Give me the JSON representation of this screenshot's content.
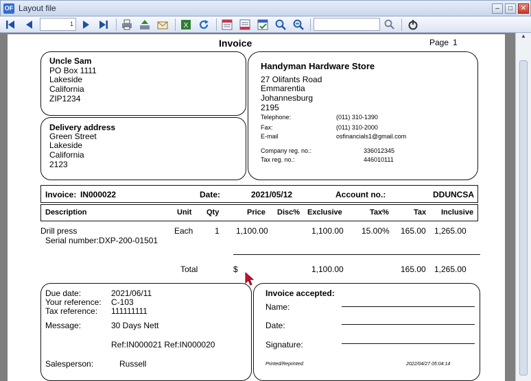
{
  "window": {
    "title": "Layout file",
    "app_icon": "OF"
  },
  "toolbar": {
    "page_number": "1",
    "search_value": "",
    "icons": [
      "first-page-icon",
      "previous-page-icon",
      "next-page-icon",
      "last-page-icon",
      "print-icon",
      "export-icon",
      "email-icon",
      "export-excel-icon",
      "refresh-icon",
      "page-layout-icon",
      "page-setup-icon",
      "check-icon",
      "zoom-in-icon",
      "zoom-out-icon",
      "search-icon",
      "exit-icon"
    ]
  },
  "invoice": {
    "title": "Invoice",
    "page_label": "Page",
    "page_number": "1",
    "customer": {
      "name": "Uncle Sam",
      "lines": [
        "PO Box 1111",
        "Lakeside",
        "California",
        "ZIP1234"
      ]
    },
    "delivery": {
      "heading": "Delivery address",
      "lines": [
        "Green Street",
        "Lakeside",
        "California",
        "2123"
      ]
    },
    "company": {
      "name": "Handyman Hardware Store",
      "lines": [
        "27 Olifants Road",
        "Emmarentia",
        "Johannesburg",
        "2195"
      ],
      "telephone_label": "Telephone:",
      "telephone": "(011) 310-1390",
      "fax_label": "Fax:",
      "fax": "(011) 310-2000",
      "email_label": "E-mail",
      "email": "osfinancials1@gmail.com",
      "reg_label": "Company reg. no.:",
      "reg": "336012345",
      "tax_label": "Tax reg. no.:",
      "tax": "446010111"
    },
    "header": {
      "invoice_label": "Invoice:",
      "invoice_no": "IN000022",
      "date_label": "Date:",
      "date": "2021/05/12",
      "account_label": "Account no.:",
      "account": "DDUNCSA"
    },
    "columns": {
      "description": "Description",
      "unit": "Unit",
      "qty": "Qty",
      "price": "Price",
      "disc": "Disc%",
      "exclusive": "Exclusive",
      "tax_pct": "Tax%",
      "tax": "Tax",
      "inclusive": "Inclusive"
    },
    "line_item": {
      "description": "Drill press",
      "serial": "Serial number:DXP-200-01501",
      "unit": "Each",
      "qty": "1",
      "price": "1,100.00",
      "exclusive": "1,100.00",
      "tax_pct": "15.00%",
      "tax": "165.00",
      "inclusive": "1,265.00"
    },
    "totals": {
      "label": "Total",
      "currency": "$",
      "exclusive": "1,100.00",
      "tax": "165.00",
      "inclusive": "1,265.00"
    },
    "footer": {
      "due_label": "Due date:",
      "due": "2021/06/11",
      "ref_label": "Your reference:",
      "ref": "C-103",
      "taxref_label": "Tax reference:",
      "taxref": "111111111",
      "message_label": "Message:",
      "message1": "30 Days Nett",
      "message2": "Ref:IN000021 Ref:IN000020",
      "sales_label": "Salesperson:",
      "sales": "Russell"
    },
    "accepted": {
      "heading": "Invoice  accepted:",
      "name_label": "Name:",
      "date_label": "Date:",
      "signature_label": "Signature:",
      "printed_label": "Printed/Reprinted:",
      "printed_time": "2022/04/27 05:04:14"
    }
  }
}
